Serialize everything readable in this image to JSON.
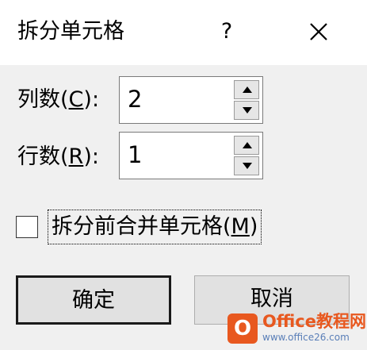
{
  "dialog": {
    "title": "拆分单元格",
    "help_label": "?",
    "close_icon": "close-icon"
  },
  "columns": {
    "label_prefix": "列数(",
    "mnemonic": "C",
    "label_suffix": "):",
    "value": "2"
  },
  "rows": {
    "label_prefix": "行数(",
    "mnemonic": "R",
    "label_suffix": "):",
    "value": "1"
  },
  "merge_checkbox": {
    "label_prefix": "拆分前合并单元格(",
    "mnemonic": "M",
    "label_suffix": ")",
    "checked": false
  },
  "buttons": {
    "ok_label": "确定",
    "cancel_label": "取消"
  },
  "watermark": {
    "logo_letter": "O",
    "text": "Office教程网",
    "url": "www.office26.com"
  }
}
